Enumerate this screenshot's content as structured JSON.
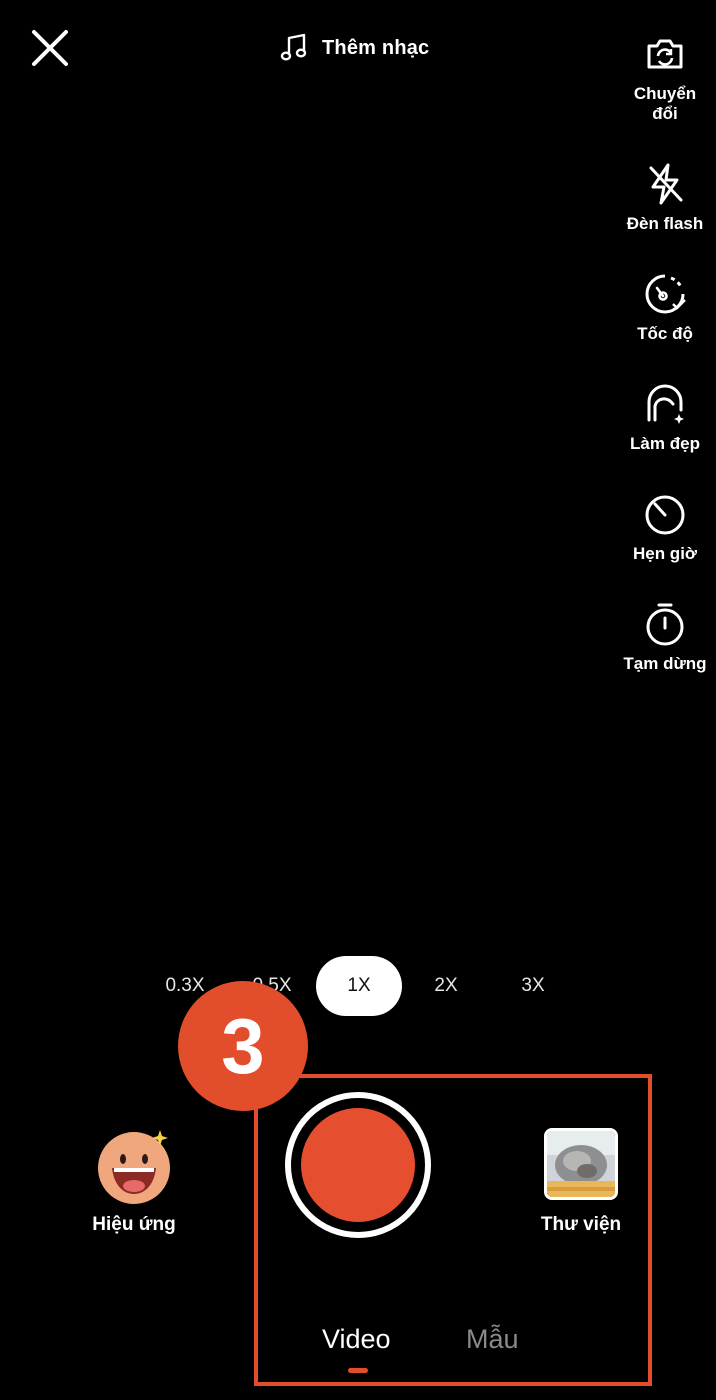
{
  "top": {
    "music_label": "Thêm nhạc"
  },
  "tools": [
    {
      "label": "Chuyển\nđổi",
      "icon": "flip-camera-icon"
    },
    {
      "label": "Đèn flash",
      "icon": "flash-off-icon"
    },
    {
      "label": "Tốc độ",
      "icon": "speed-icon"
    },
    {
      "label": "Làm đẹp",
      "icon": "beauty-icon"
    },
    {
      "label": "Hẹn giờ",
      "icon": "timer-icon"
    },
    {
      "label": "Tạm dừng",
      "icon": "stopwatch-icon"
    }
  ],
  "zoom": {
    "options": [
      "0.3X",
      "0.5X",
      "1X",
      "2X",
      "3X"
    ],
    "selected": "1X"
  },
  "step_badge": "3",
  "bottom": {
    "effects_label": "Hiệu ứng",
    "gallery_label": "Thư viện",
    "modes": [
      "Video",
      "Mẫu"
    ],
    "active_mode": "Video"
  },
  "colors": {
    "accent": "#e24d2c",
    "record": "#e54e2e",
    "background": "#000000"
  }
}
